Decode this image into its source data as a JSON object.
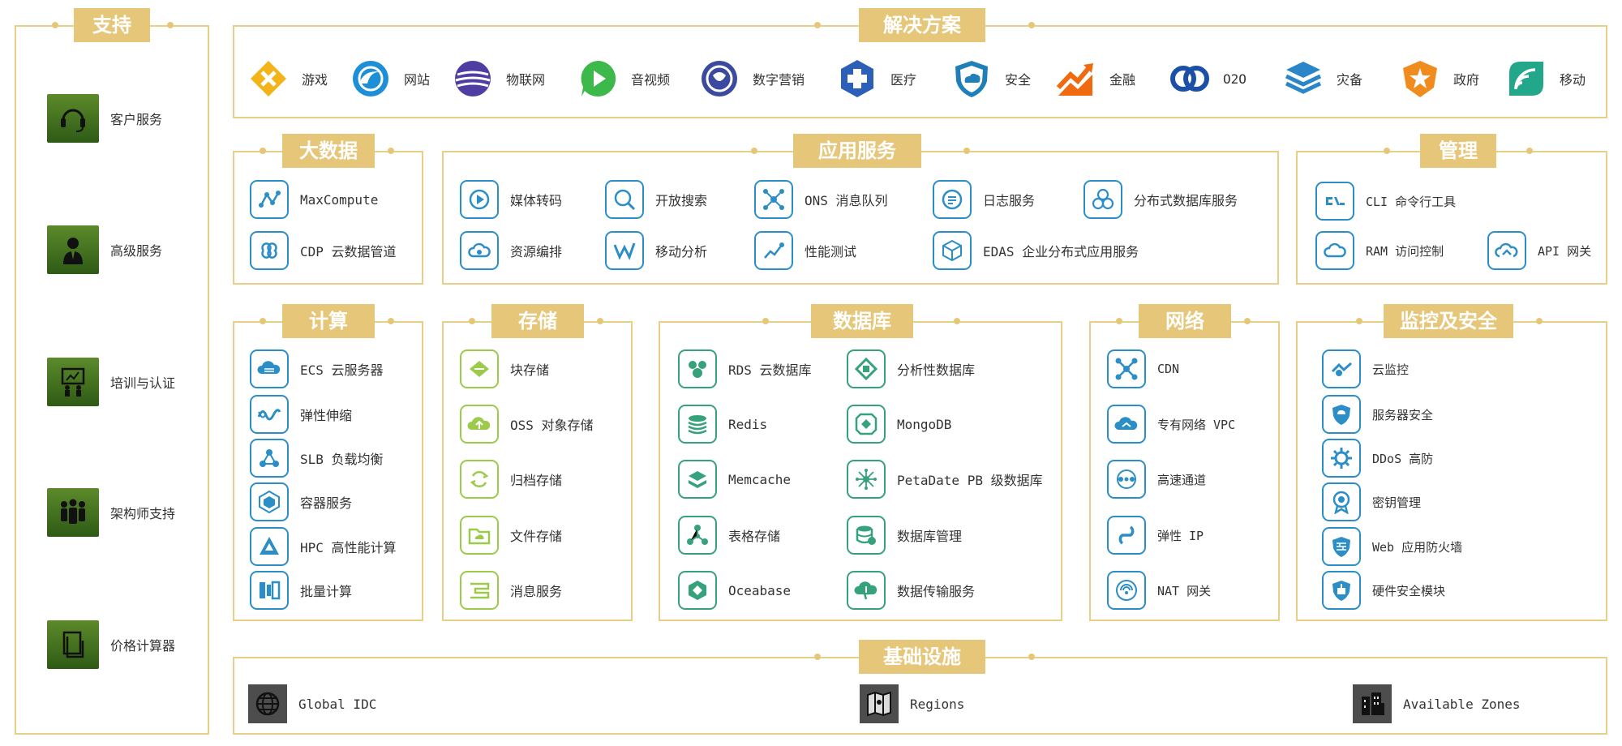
{
  "support": {
    "title": "支持",
    "items": [
      "客户服务",
      "高级服务",
      "培训与认证",
      "架构师支持",
      "价格计算器"
    ]
  },
  "solutions": {
    "title": "解决方案",
    "items": [
      {
        "label": "游戏",
        "icon": "game-icon"
      },
      {
        "label": "网站",
        "icon": "website-icon"
      },
      {
        "label": "物联网",
        "icon": "iot-icon"
      },
      {
        "label": "音视频",
        "icon": "video-icon"
      },
      {
        "label": "数字营销",
        "icon": "marketing-icon"
      },
      {
        "label": "医疗",
        "icon": "medical-icon"
      },
      {
        "label": "安全",
        "icon": "security-icon"
      },
      {
        "label": "金融",
        "icon": "finance-icon"
      },
      {
        "label": "O2O",
        "icon": "o2o-icon"
      },
      {
        "label": "灾备",
        "icon": "disaster-recovery-icon"
      },
      {
        "label": "政府",
        "icon": "government-icon"
      },
      {
        "label": "移动",
        "icon": "mobile-icon"
      }
    ]
  },
  "bigdata": {
    "title": "大数据",
    "items": [
      "MaxCompute",
      "CDP 云数据管道"
    ]
  },
  "appservice": {
    "title": "应用服务",
    "items": [
      "媒体转码",
      "开放搜索",
      "ONS 消息队列",
      "日志服务",
      "分布式数据库服务",
      "资源编排",
      "移动分析",
      "性能测试",
      "EDAS 企业分布式应用服务"
    ]
  },
  "management": {
    "title": "管理",
    "items": [
      "CLI 命令行工具",
      "RAM 访问控制",
      "API 网关"
    ]
  },
  "compute": {
    "title": "计算",
    "items": [
      "ECS 云服务器",
      "弹性伸缩",
      "SLB 负载均衡",
      "容器服务",
      "HPC 高性能计算",
      "批量计算"
    ]
  },
  "storage": {
    "title": "存储",
    "items": [
      "块存储",
      "OSS 对象存储",
      "归档存储",
      "文件存储",
      "消息服务"
    ]
  },
  "database": {
    "title": "数据库",
    "items": [
      "RDS 云数据库",
      "分析性数据库",
      "Redis",
      "MongoDB",
      "Memcache",
      "PetaDate PB 级数据库",
      "表格存储",
      "数据库管理",
      "Oceabase",
      "数据传输服务"
    ]
  },
  "network": {
    "title": "网络",
    "items": [
      "CDN",
      "专有网络 VPC",
      "高速通道",
      "弹性 IP",
      "NAT 网关"
    ]
  },
  "monitoring": {
    "title": "监控及安全",
    "items": [
      "云监控",
      "服务器安全",
      "DDoS 高防",
      "密钥管理",
      "Web 应用防火墙",
      "硬件安全模块"
    ]
  },
  "infrastructure": {
    "title": "基础设施",
    "items": [
      "Global IDC",
      "Regions",
      "Available Zones"
    ]
  },
  "colors": {
    "accent": "#e6c77a",
    "border": "#e8cf88",
    "iconBlue": "#2c8ec7",
    "iconGreen": "#36a27c",
    "iconLime": "#9ccb4c"
  }
}
